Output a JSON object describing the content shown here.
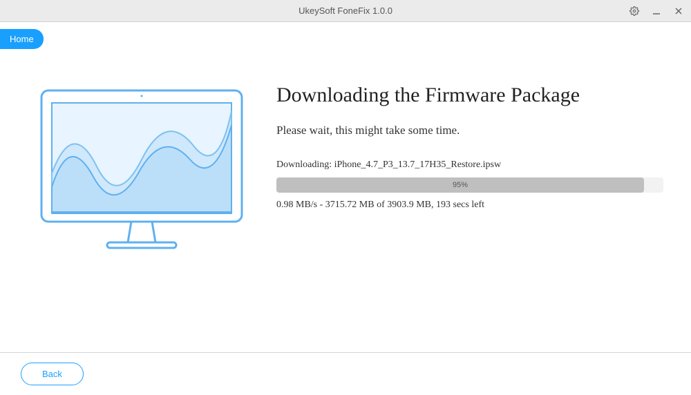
{
  "titlebar": {
    "title": "UkeySoft FoneFix 1.0.0"
  },
  "nav": {
    "home": "Home"
  },
  "download": {
    "heading": "Downloading the Firmware Package",
    "subheading": "Please wait, this might take some time.",
    "filename_label": "Downloading: iPhone_4.7_P3_13.7_17H35_Restore.ipsw",
    "progress_percent": "95%",
    "progress_width": "95%",
    "stats": "0.98 MB/s - 3715.72 MB of 3903.9 MB, 193 secs left"
  },
  "footer": {
    "back": "Back"
  }
}
